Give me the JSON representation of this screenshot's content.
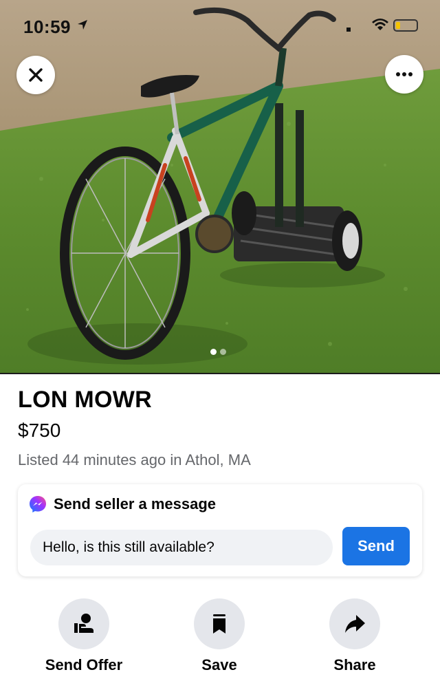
{
  "status_bar": {
    "time": "10:59",
    "location_icon": "location-arrow-icon",
    "wifi_icon": "wifi-icon",
    "battery_icon": "battery-low-icon",
    "battery_color": "#f5c400"
  },
  "photo": {
    "subject": "green bicycle attached to reel lawn mower on grass",
    "total_images": 2,
    "current_image": 1
  },
  "top_buttons": {
    "close_icon": "close-icon",
    "more_icon": "more-options-icon"
  },
  "listing": {
    "title": "LON MOWR",
    "price": "$750",
    "listed_text": "Listed 44 minutes ago in Athol, MA"
  },
  "message": {
    "header": "Send seller a message",
    "input_value": "Hello, is this still available?",
    "send_label": "Send",
    "messenger_icon": "messenger-icon"
  },
  "actions": [
    {
      "label": "Send Offer",
      "icon": "send-offer-icon"
    },
    {
      "label": "Save",
      "icon": "bookmark-icon"
    },
    {
      "label": "Share",
      "icon": "share-arrow-icon"
    }
  ],
  "colors": {
    "accent": "#1b74e4",
    "secondary_text": "#65676b",
    "input_bg": "#f0f2f5",
    "action_bg": "#e4e6eb"
  }
}
